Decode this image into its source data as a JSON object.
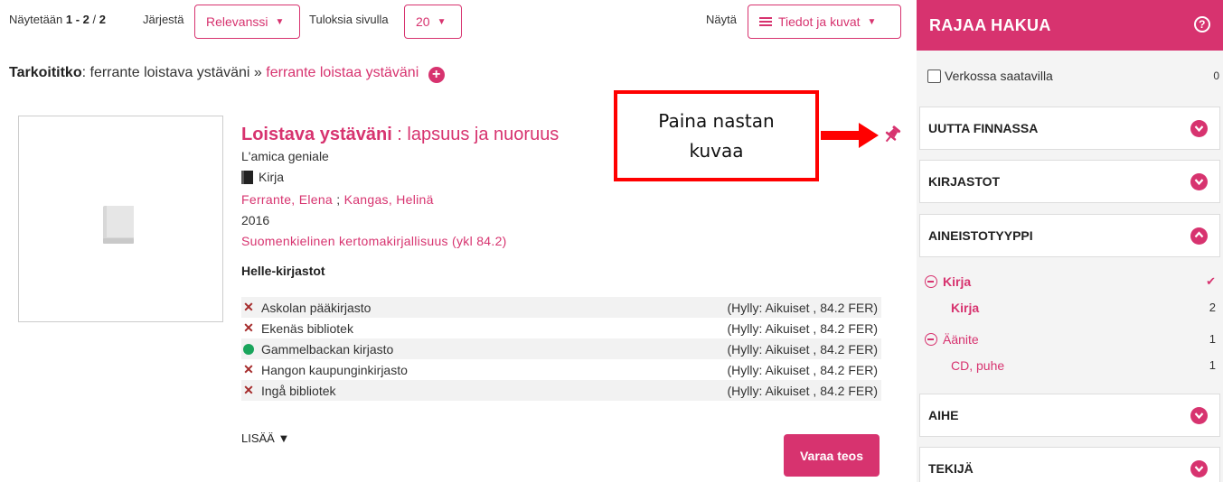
{
  "toolbar": {
    "showing_prefix": "Näytetään",
    "showing_range": "1 - 2",
    "showing_sep": "/",
    "showing_total": "2",
    "sort_label": "Järjestä",
    "sort_value": "Relevanssi",
    "per_page_label": "Tuloksia sivulla",
    "per_page_value": "20",
    "view_label": "Näytä",
    "view_value": "Tiedot ja kuvat"
  },
  "did_you_mean": {
    "label": "Tarkoititko",
    "original": ": ferrante loistava ystäväni »",
    "suggestion": "ferrante loistaa ystäväni"
  },
  "record": {
    "title_main": "Loistava ystäväni",
    "title_sub": " : lapsuus ja nuoruus",
    "original_title": "L'amica geniale",
    "format": "Kirja",
    "author_1": "Ferrante, Elena",
    "author_sep": " ; ",
    "author_2": "Kangas, Helinä",
    "year": "2016",
    "subject": "Suomenkielinen kertomakirjallisuus (ykl 84.2)",
    "organisation": "Helle-kirjastot",
    "holdings": [
      {
        "status": "unavailable",
        "library": "Askolan pääkirjasto",
        "location": "(Hylly: Aikuiset , 84.2 FER)"
      },
      {
        "status": "unavailable",
        "library": "Ekenäs bibliotek",
        "location": "(Hylly: Aikuiset , 84.2 FER)"
      },
      {
        "status": "available",
        "library": "Gammelbackan kirjasto",
        "location": "(Hylly: Aikuiset , 84.2 FER)"
      },
      {
        "status": "unavailable",
        "library": "Hangon kaupunginkirjasto",
        "location": "(Hylly: Aikuiset , 84.2 FER)"
      },
      {
        "status": "unavailable",
        "library": "Ingå bibliotek",
        "location": "(Hylly: Aikuiset , 84.2 FER)"
      }
    ],
    "more_label": "LISÄÄ ▼",
    "reserve_label": "Varaa teos"
  },
  "annotation": {
    "line1": "Paina nastan",
    "line2": "kuvaa"
  },
  "sidebar": {
    "title": "RAJAA HAKUA",
    "help": "?",
    "online_label": "Verkossa saatavilla",
    "online_count": "0",
    "facets": [
      "UUTTA FINNASSA",
      "KIRJASTOT",
      "AINEISTOTYYPPI",
      "AIHE",
      "TEKIJÄ"
    ],
    "type_values": [
      {
        "label": "Kirja",
        "count": "",
        "selected": true
      },
      {
        "label": "Kirja",
        "count": "2"
      },
      {
        "label": "Äänite",
        "count": "1"
      },
      {
        "label": "CD, puhe",
        "count": "1"
      }
    ]
  },
  "colors": {
    "accent": "#d7336f",
    "available": "#1aa55c",
    "unavailable": "#a52a2a",
    "annotation": "#ff0000"
  }
}
